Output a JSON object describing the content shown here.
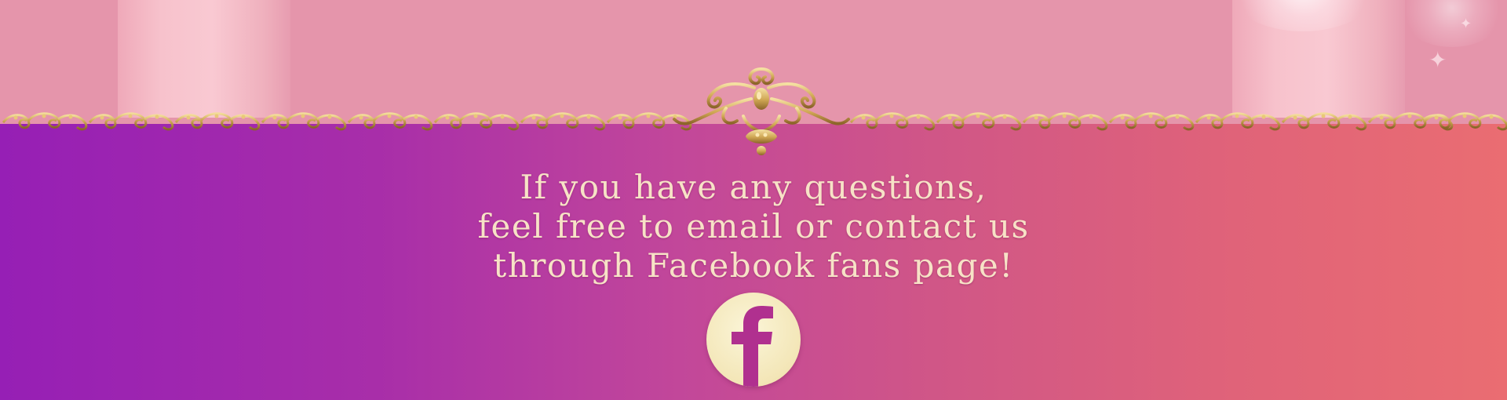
{
  "header": {
    "decoration": "gold-filigree-border"
  },
  "message": {
    "lines": [
      "If you have any questions,",
      "feel free to email or contact us",
      "through Facebook fans page!"
    ]
  },
  "social": {
    "facebook_icon": "facebook-icon"
  },
  "colors": {
    "top_background": "#e595ab",
    "gradient_left": "#961fb5",
    "gradient_right": "#ea6d72",
    "text": "#f7e2c6",
    "gold": "#c9a44f",
    "facebook_button": "#f3e6b7",
    "facebook_f": "#b0308f"
  }
}
